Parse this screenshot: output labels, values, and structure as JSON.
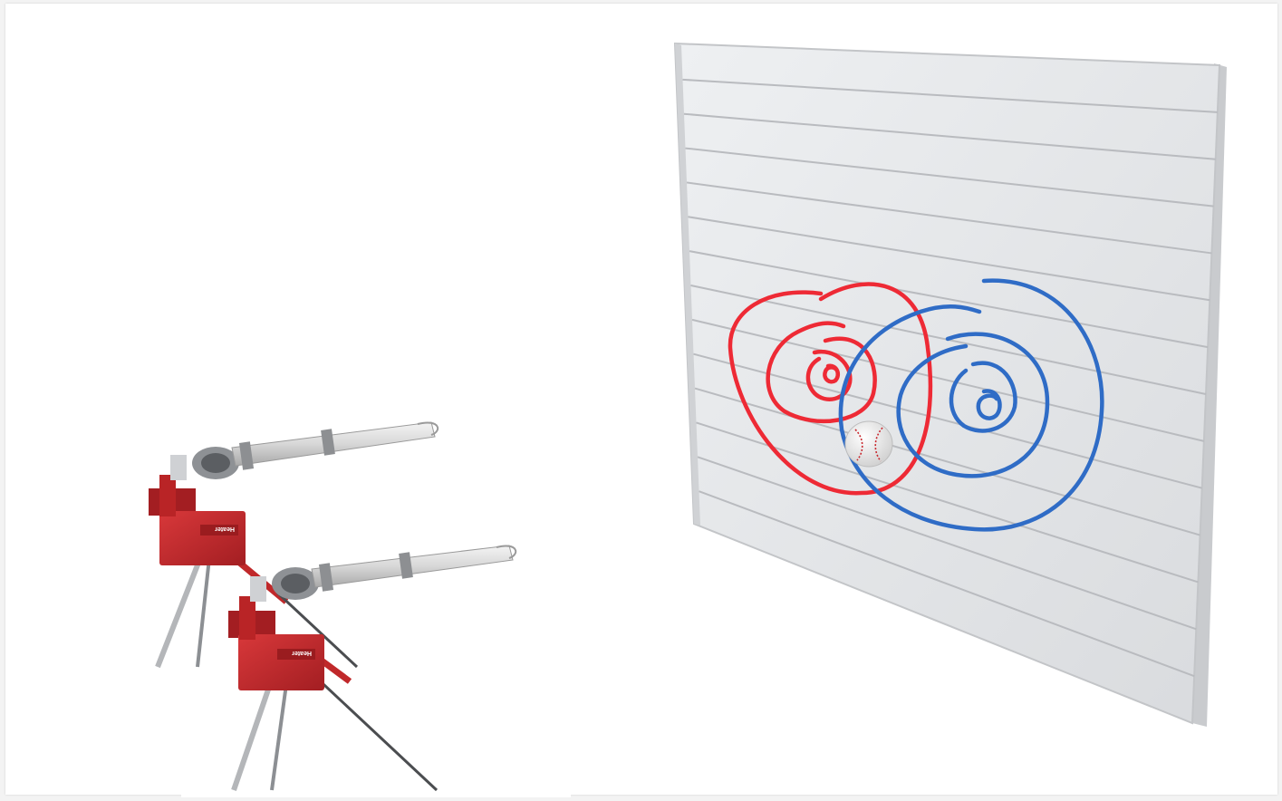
{
  "slide": {
    "background": "#ffffff",
    "page_background": "#f3f3f3"
  },
  "machines": [
    {
      "name": "pitching-machine-back",
      "brand_label": "Heater",
      "color": "#c0282a"
    },
    {
      "name": "pitching-machine-front",
      "brand_label": "Heater",
      "color": "#c0282a"
    }
  ],
  "wall": {
    "panel_color": "#e7e8ea",
    "slat_line_color": "#b9bbbf",
    "frame_color": "#d4d6d9"
  },
  "target_zones": [
    {
      "name": "red-target",
      "color": "#ee2a35",
      "ring_count": 4
    },
    {
      "name": "blue-target",
      "color": "#2f6cc6",
      "ring_count": 4
    }
  ],
  "ball": {
    "name": "baseball",
    "color": "#f4f4f4",
    "stitch_color": "#c8272d"
  }
}
